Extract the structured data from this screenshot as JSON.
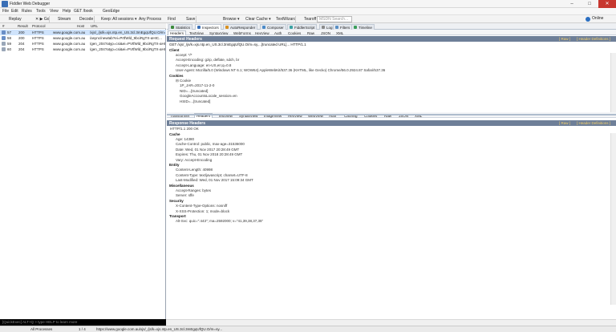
{
  "window": {
    "title": "Fiddler Web Debugger",
    "min": "–",
    "max": "□",
    "close": "✕"
  },
  "menu": [
    "File",
    "Edit",
    "Rules",
    "Tools",
    "View",
    "Help",
    "GET /book",
    "GeoEdge"
  ],
  "toolbar": {
    "items": [
      {
        "label": "Replay",
        "color": "#3b7d2f"
      },
      {
        "label": "✕ ▶ Go",
        "color": "#3d8f3d"
      },
      {
        "label": "Stream",
        "color": "#4a6fb3"
      },
      {
        "label": "Decode",
        "color": "#6d6d6d"
      },
      {
        "label": "Keep: All sessions ▾",
        "color": "#f3f3f3"
      },
      {
        "label": "Any Process",
        "color": "#3a8ad6"
      },
      {
        "label": "Find",
        "color": "#6b8fbf"
      },
      {
        "label": "Save",
        "color": "#3f62a8"
      },
      {
        "label": "",
        "color": "#7d7d7d"
      },
      {
        "label": "",
        "color": "#c44a3a"
      },
      {
        "label": "Browse ▾",
        "color": "#2b7ac9"
      },
      {
        "label": "Clear Cache ▾",
        "color": "#c33b3b"
      },
      {
        "label": "TextWizard",
        "color": "#8b5fb4"
      },
      {
        "label": "Tearoff",
        "color": "#7a7a7a"
      }
    ],
    "search_placeholder": "MSDN Search...",
    "online": "Online"
  },
  "sessions": {
    "columns": [
      "#",
      "Result",
      "Protocol",
      "Host",
      "URL"
    ],
    "rows": [
      {
        "id": "57",
        "result": "200",
        "protocol": "HTTPS",
        "host": "www.google.com.au",
        "url": "/xjs/_/js/k=xjs.ntp.en_US.3cl.3mEgqUfQU.O/m=sy..."
      },
      {
        "id": "58",
        "result": "200",
        "protocol": "HTTPS",
        "host": "www.google.com.au",
        "url": "/async/newtab?ei=PrtfWld_9bciRgTX-aHIC..."
      },
      {
        "id": "59",
        "result": "204",
        "protocol": "HTTPS",
        "host": "www.google.com.au",
        "url": "/gen_204?atyp=csi&ei=PVtfWld_9bciRgTX-aHIC..."
      },
      {
        "id": "60",
        "result": "204",
        "protocol": "HTTPS",
        "host": "www.google.com.au",
        "url": "/gen_204?atyp=csi&ei=PVtfWld_9bciRgTX-aHIC..."
      }
    ]
  },
  "main_tabs": [
    {
      "label": "Statistics",
      "color": "#3b8a3b"
    },
    {
      "label": "Inspectors",
      "color": "#3a6fb6"
    },
    {
      "label": "AutoResponder",
      "color": "#d9901f"
    },
    {
      "label": "Composer",
      "color": "#4a8ac8"
    },
    {
      "label": "FiddlerScript",
      "color": "#3aa2a2"
    },
    {
      "label": "Log",
      "color": "#8a8a8a"
    },
    {
      "label": "Filters",
      "color": "#5a8fc4"
    },
    {
      "label": "Timeline",
      "color": "#3a9e5a"
    }
  ],
  "request_tabs": [
    "Headers",
    "TextView",
    "SyntaxView",
    "WebForms",
    "HexView",
    "Auth",
    "Cookies",
    "Raw",
    "JSON",
    "XML"
  ],
  "request": {
    "title": "Request Headers",
    "raw_link": "[ Raw ]",
    "defs_link": "[ Header Definitions ]",
    "request_line": "GET /xjs/_/js/k=xjs.ntp.en_US.3cl.3mEgqUfQU.O/m=sy,...[truncated URL]... HTTP/1.1",
    "lines": [
      {
        "text": "Client",
        "kind": "section"
      },
      {
        "text": "accept: */*",
        "kind": "item"
      },
      {
        "text": "Accept-Encoding: gzip, deflate, sdch, br",
        "kind": "item"
      },
      {
        "text": "Accept-Language: en-US,en;q=0.8",
        "kind": "item"
      },
      {
        "text": "User-Agent: Mozilla/5.0 (Windows NT 6.1; WOW64) AppleWebKit/537.36 (KHTML, like Gecko) Chrome/56.0.2924.87 Safari/537.36",
        "kind": "item"
      },
      {
        "text": "Cookies",
        "kind": "section"
      },
      {
        "text": "⊟ Cookie",
        "kind": "item"
      },
      {
        "text": "1P_JAR=2017-11-2-0",
        "kind": "sub"
      },
      {
        "text": "NID=...[truncated]",
        "kind": "sub"
      },
      {
        "text": "GoogleAccountsLocale_session=en",
        "kind": "sub"
      },
      {
        "text": "HSID=...[truncated]",
        "kind": "sub"
      }
    ]
  },
  "response_tabs": [
    "Transformer",
    "Headers",
    "TextView",
    "SyntaxView",
    "ImageView",
    "HexView",
    "WebView",
    "Auth",
    "Caching",
    "Cookies",
    "Raw",
    "JSON",
    "XML"
  ],
  "response": {
    "title": "Response Headers",
    "raw_link": "[ Raw ]",
    "defs_link": "[ Header Definitions ]",
    "status_line": "HTTP/1.1 200 OK",
    "lines": [
      {
        "text": "Cache",
        "kind": "section"
      },
      {
        "text": "Age: 14380",
        "kind": "item"
      },
      {
        "text": "Cache-Control: public, max-age=31536000",
        "kind": "item"
      },
      {
        "text": "Date: Wed, 01 Nov 2017 20:28:49 GMT",
        "kind": "item"
      },
      {
        "text": "Expires: Thu, 01 Nov 2018 20:28:49 GMT",
        "kind": "item"
      },
      {
        "text": "Vary: Accept-Encoding",
        "kind": "item"
      },
      {
        "text": "Entity",
        "kind": "section"
      },
      {
        "text": "Content-Length: 40998",
        "kind": "item"
      },
      {
        "text": "Content-Type: text/javascript; charset=UTF-8",
        "kind": "item"
      },
      {
        "text": "Last-Modified: Wed, 01 Nov 2017 15:09:34 GMT",
        "kind": "item"
      },
      {
        "text": "Miscellaneous",
        "kind": "section"
      },
      {
        "text": "Accept-Ranges: bytes",
        "kind": "item"
      },
      {
        "text": "Server: sffe",
        "kind": "item"
      },
      {
        "text": "Security",
        "kind": "section"
      },
      {
        "text": "X-Content-Type-Options: nosniff",
        "kind": "item"
      },
      {
        "text": "X-XSS-Protection: 1; mode=block",
        "kind": "item"
      },
      {
        "text": "Transport",
        "kind": "section"
      },
      {
        "text": "Alt-Svc: quic=\":443\"; ma=2592000; v=\"41,39,38,37,35\"",
        "kind": "item"
      }
    ]
  },
  "quickexec": "[QuickExec] ALT+Q > type HELP to learn more",
  "status": {
    "capture": "",
    "processes": "All Processes",
    "count": "1 / 4",
    "url": "https://www.google.com.au/xjs/_/js/k=xjs.ntp.en_US.3cl.3mEgqUfQU.O/m=sy..."
  }
}
